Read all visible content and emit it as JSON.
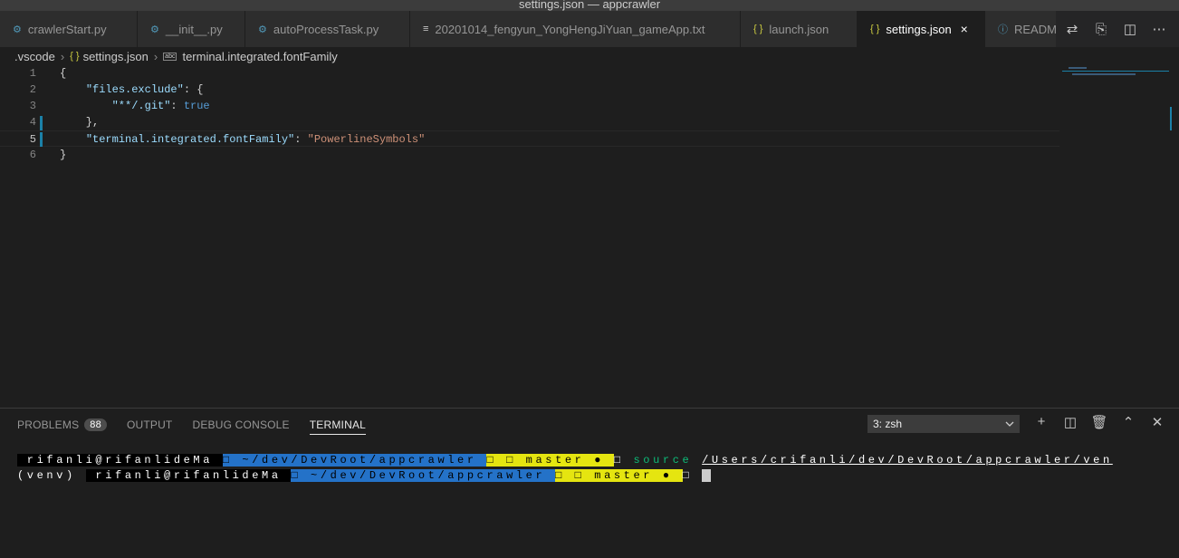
{
  "window": {
    "title": "settings.json — appcrawler"
  },
  "tabs": [
    {
      "label": "crawlerStart.py",
      "icon": "python-icon",
      "glyph": "⚙"
    },
    {
      "label": "__init__.py",
      "icon": "python-icon",
      "glyph": "⚙"
    },
    {
      "label": "autoProcessTask.py",
      "icon": "python-icon",
      "glyph": "⚙"
    },
    {
      "label": "20201014_fengyun_YongHengJiYuan_gameApp.txt",
      "icon": "text-file-icon",
      "glyph": "≡"
    },
    {
      "label": "launch.json",
      "icon": "json-icon",
      "glyph": "{ }"
    },
    {
      "label": "settings.json",
      "icon": "json-icon",
      "glyph": "{ }",
      "close": "×"
    },
    {
      "label": "READM",
      "icon": "info-icon",
      "glyph": "ⓘ"
    }
  ],
  "tab_actions": [
    "⇄",
    "⎘",
    "◫",
    "⋯"
  ],
  "breadcrumb": {
    "folder": ".vscode",
    "file_icon": "{ }",
    "file": "settings.json",
    "symbol_icon": "abc",
    "symbol": "terminal.integrated.fontFamily",
    "sep": "›"
  },
  "editor": {
    "lines": [
      {
        "num": "1",
        "text": "{"
      },
      {
        "num": "2",
        "key": "\"files.exclude\"",
        "rest": ": {"
      },
      {
        "num": "3",
        "key": "\"**/.git\"",
        "rest": ": ",
        "value": "true"
      },
      {
        "num": "4",
        "text": "    },"
      },
      {
        "num": "5",
        "key": "\"terminal.integrated.fontFamily\"",
        "rest": ": ",
        "value": "\"PowerlineSymbols\""
      },
      {
        "num": "6",
        "text": "}"
      }
    ]
  },
  "panel": {
    "tabs": [
      "PROBLEMS",
      "OUTPUT",
      "DEBUG CONSOLE",
      "TERMINAL"
    ],
    "problems_count": "88",
    "terminal_select": "3: zsh",
    "actions": [
      "+",
      "◫",
      "🗑",
      "⌃",
      "✕"
    ]
  },
  "terminal": {
    "line1": {
      "user": " rifanli@rifanlideMa ",
      "dir": "□ ~/dev/DevRoot/appcrawler ",
      "branch": "□ □ master ● ",
      "tail_mark": "□",
      "cmd": " source",
      "path": "/Users/crifanli/dev/DevRoot/appcrawler/ven"
    },
    "line2": {
      "venv": "(venv) ",
      "user": " rifanli@rifanlideMa ",
      "dir": "□ ~/dev/DevRoot/appcrawler ",
      "branch": "□ □ master ● ",
      "tail_mark": "□"
    }
  },
  "colors": {
    "accent": "#1b81a8",
    "segment_blue": "#2472c8",
    "segment_yellow": "#e5e510",
    "command_green": "#0dbc79"
  }
}
